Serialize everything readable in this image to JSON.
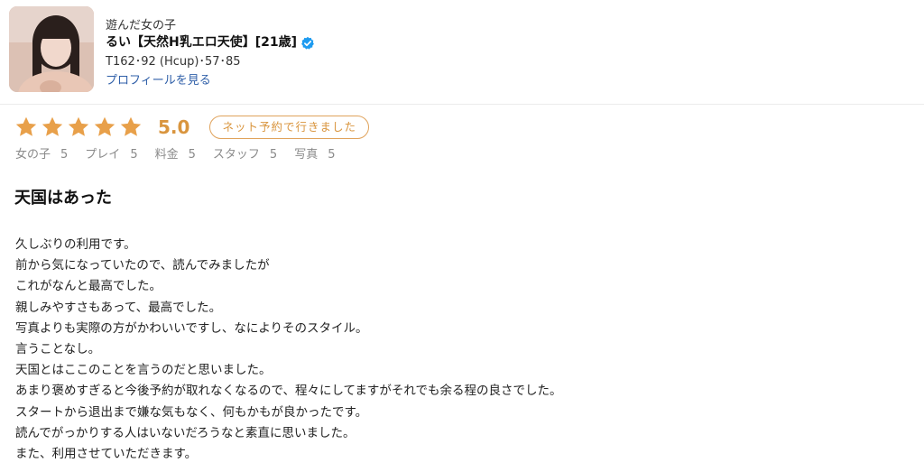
{
  "profile": {
    "category": "遊んだ女の子",
    "name": "るい【天然H乳エロ天使】[21歳]",
    "specs": "T162･92 (Hcup)･57･85",
    "link_label": "プロフィールを見る",
    "verified_icon": "verified-check-icon",
    "verified_color": "#1d9bf0"
  },
  "rating": {
    "stars": 5,
    "max_stars": 5,
    "score": "5.0",
    "star_color": "#e8a04a",
    "badge": "ネット予約で行きました"
  },
  "sub_scores": [
    {
      "label": "女の子",
      "value": "5"
    },
    {
      "label": "プレイ",
      "value": "5"
    },
    {
      "label": "料金",
      "value": "5"
    },
    {
      "label": "スタッフ",
      "value": "5"
    },
    {
      "label": "写真",
      "value": "5"
    }
  ],
  "review": {
    "title": "天国はあった",
    "lines": [
      "久しぶりの利用です。",
      "前から気になっていたので、読んでみましたが",
      "これがなんと最高でした。",
      "親しみやすさもあって、最高でした。",
      "写真よりも実際の方がかわいいですし、なによりそのスタイル。",
      "言うことなし。",
      "天国とはここのことを言うのだと思いました。",
      "あまり褒めすぎると今後予約が取れなくなるので、程々にしてますがそれでも余る程の良さでした。",
      "スタートから退出まで嫌な気もなく、何もかもが良かったです。",
      "読んでがっかりする人はいないだろうなと素直に思いました。",
      "また、利用させていただきます。"
    ]
  }
}
